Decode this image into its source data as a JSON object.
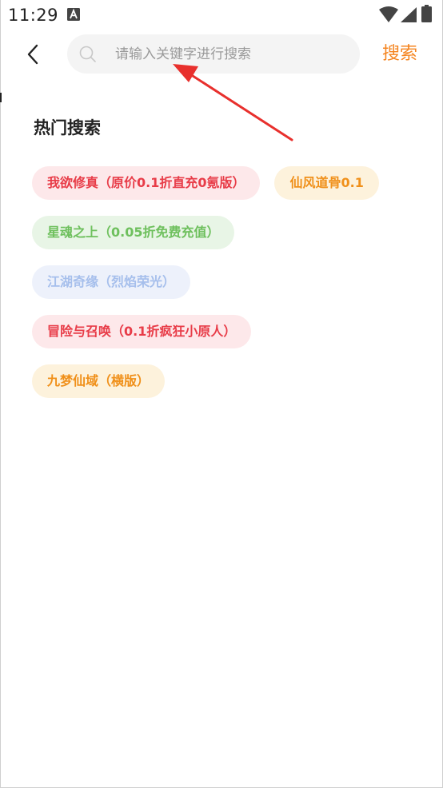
{
  "status_bar": {
    "time": "11:29",
    "notification_icon": "a-notification-icon"
  },
  "header": {
    "back_icon": "chevron-left-icon",
    "search": {
      "placeholder": "请输入关键字进行搜索",
      "value": ""
    },
    "search_button_label": "搜索"
  },
  "hot_search": {
    "title": "热门搜索",
    "tags": [
      {
        "label": "我欲修真（原价0.1折直充0氪版）",
        "text_color": "#e83c48",
        "bg_color": "#fde8ea"
      },
      {
        "label": "仙风道骨0.1",
        "text_color": "#f0901a",
        "bg_color": "#fdf2dc"
      },
      {
        "label": "星魂之上（0.05折免费充值）",
        "text_color": "#6ec05d",
        "bg_color": "#e8f5e6"
      },
      {
        "label": "江湖奇缘（烈焰荣光）",
        "text_color": "#a6bfec",
        "bg_color": "#edf1fb"
      },
      {
        "label": "冒险与召唤（0.1折疯狂小原人）",
        "text_color": "#e83c48",
        "bg_color": "#fde8ea"
      },
      {
        "label": "九梦仙域（横版）",
        "text_color": "#f0901a",
        "bg_color": "#fdf2dc"
      }
    ]
  },
  "colors": {
    "accent": "#f5841f",
    "annotation_arrow": "#e8302d"
  }
}
